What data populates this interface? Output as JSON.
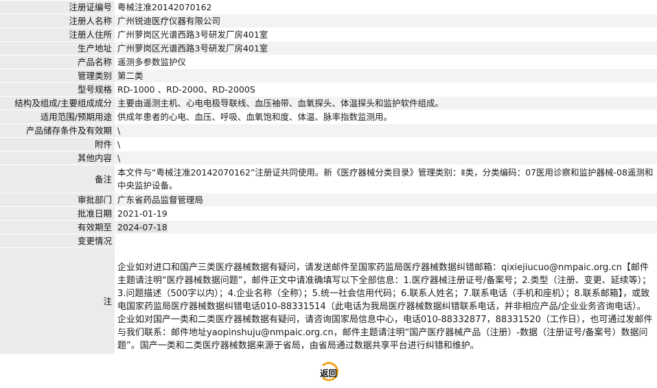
{
  "rows": [
    {
      "label": "注册证编号",
      "value": "粤械注准20142070162"
    },
    {
      "label": "注册人名称",
      "value": "广州锐迪医疗仪器有限公司"
    },
    {
      "label": "注册人住所",
      "value": "广州萝岗区光谱西路3号研发厂房401室"
    },
    {
      "label": "生产地址",
      "value": "广州萝岗区光谱西路3号研发厂房401室"
    },
    {
      "label": "产品名称",
      "value": "遥测多参数监护仪"
    },
    {
      "label": "管理类别",
      "value": "第二类"
    },
    {
      "label": "型号规格",
      "value": "RD-1000 、RD-2000、RD-2000S"
    },
    {
      "label": "结构及组成/主要组成成分",
      "value": "主要由遥测主机、心电电极导联线、血压袖带、血氧探头、体温探头和监护软件组成。"
    },
    {
      "label": "适用范围/预期用途",
      "value": "供成年患者的心电、血压、呼吸、血氧饱和度、体温、脉率指数监测用。"
    },
    {
      "label": "产品储存条件及有效期",
      "value": "\\"
    },
    {
      "label": "附件",
      "value": "\\"
    },
    {
      "label": "其他内容",
      "value": "\\"
    },
    {
      "label": "备注",
      "value": "本文件与“粤械注准20142070162”注册证共同使用。新《医疗器械分类目录》管理类别：Ⅱ类，分类编码：07医用诊察和监护器械-08遥测和中央监护设备。"
    },
    {
      "label": "审批部门",
      "value": "广东省药品监督管理局"
    },
    {
      "label": "批准日期",
      "value": "2021-01-19"
    },
    {
      "label": "有效期至",
      "value": "2024-07-18"
    },
    {
      "label": "变更情况",
      "value": ""
    }
  ],
  "note": {
    "label": "注",
    "text": "企业如对进口和国产三类医疗器械数据有疑问，请发送邮件至国家药监局医疗器械数据纠错邮箱：qixiejiucuo@nmpaic.org.cn【邮件主题请注明“医疗器械数据问题”，邮件正文中请准确填写以下全部信息：1.医疗器械注册证号/备案号；2.类型（注册、变更、延续等）；3.问题描述（500字以内）；4.企业名称（全称）；5.统一社会信用代码；6.联系人姓名；7.联系电话（手机和座机）；8.联系邮箱】，或致电国家药监局医疗器械数据纠错电话010-88331514（此电话为我局医疗器械数据纠错联系电话，并非相应产品/企业业务咨询电话）。企业如对国产一类和二类医疗器械数据有疑问，请咨询国家局信息中心，电话010-88332877，88331520（工作日），也可通过发邮件与我们联系：邮件地址yaopinshuju@nmpaic.org.cn，邮件主题请注明“国产医疗器械产品（注册）-数据（注册证号/备案号）数据问题”。国产一类和二类医疗器械数据来源于省局，由省局通过数据共享平台进行纠错和维护。"
  },
  "back_button": {
    "label": "返回",
    "icon": "back-ring-icon",
    "accent": "#f0a11a"
  }
}
